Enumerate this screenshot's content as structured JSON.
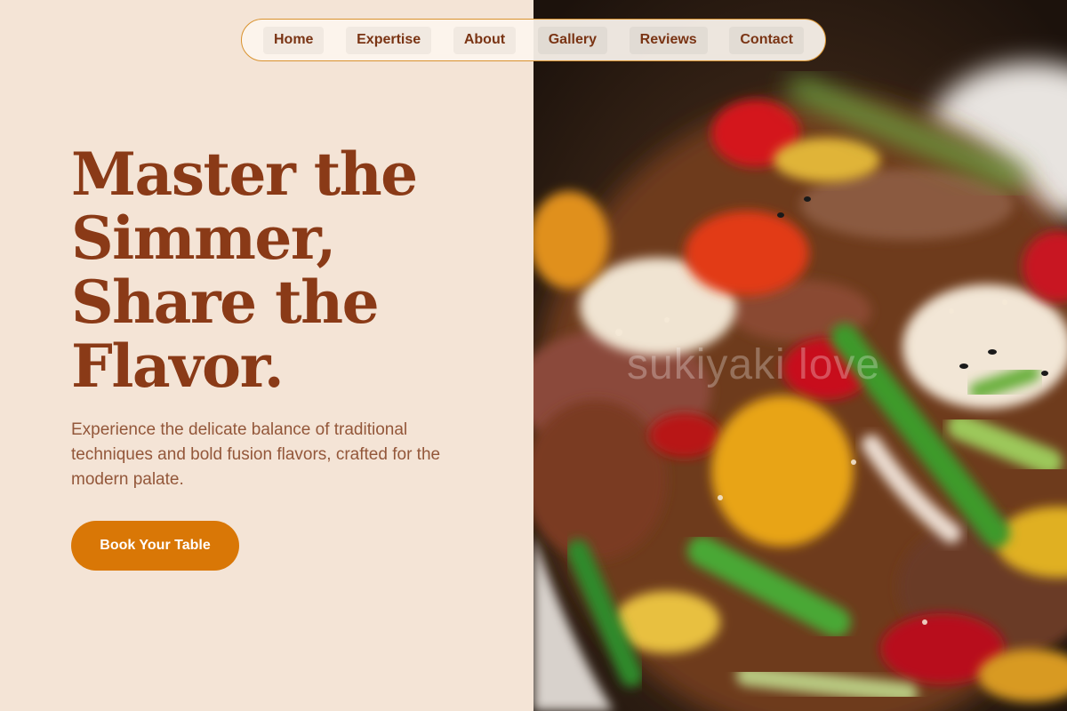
{
  "nav": {
    "items": [
      {
        "label": "Home"
      },
      {
        "label": "Expertise"
      },
      {
        "label": "About"
      },
      {
        "label": "Gallery"
      },
      {
        "label": "Reviews"
      },
      {
        "label": "Contact"
      }
    ]
  },
  "hero": {
    "headline": [
      "Master the",
      "Simmer,",
      "Share the",
      "Flavor."
    ],
    "description": "Experience the delicate balance of traditional techniques and bold fusion flavors, crafted for the modern palate.",
    "cta_label": "Book Your Table",
    "image": {
      "subject": "sukiyaki stir-fry dish with beef, quail eggs, peppers and scallions",
      "watermark": "sukiyaki love"
    }
  },
  "colors": {
    "background": "#f4e4d6",
    "heading": "#8a3a17",
    "body_text": "#93573a",
    "accent": "#d97706",
    "nav_border": "#d9922e"
  }
}
